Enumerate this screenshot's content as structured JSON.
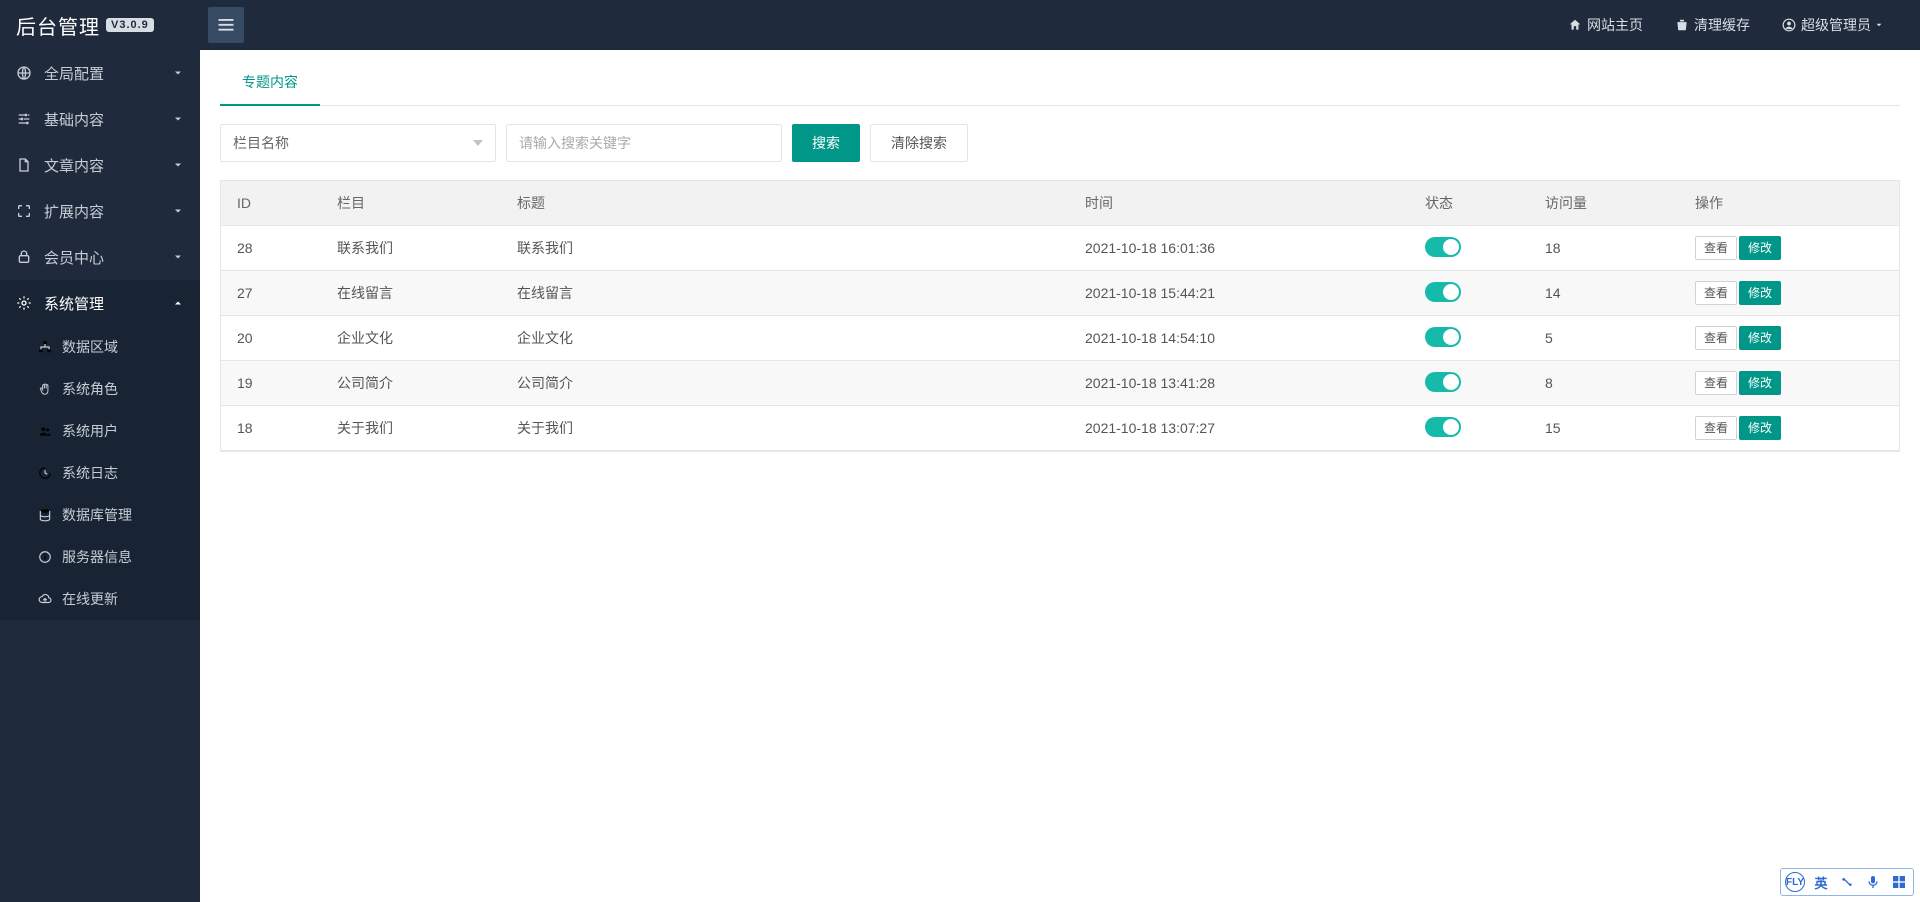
{
  "brand": {
    "title": "后台管理",
    "version": "V3.0.9"
  },
  "topbar": {
    "links": {
      "home": "网站主页",
      "cache": "清理缓存",
      "user": "超级管理员"
    }
  },
  "sidebar": {
    "items": [
      {
        "key": "global",
        "label": "全局配置",
        "icon": "globe",
        "expanded": false
      },
      {
        "key": "base",
        "label": "基础内容",
        "icon": "sliders",
        "expanded": false
      },
      {
        "key": "article",
        "label": "文章内容",
        "icon": "doc",
        "expanded": false
      },
      {
        "key": "ext",
        "label": "扩展内容",
        "icon": "expand",
        "expanded": false
      },
      {
        "key": "member",
        "label": "会员中心",
        "icon": "lock",
        "expanded": false
      },
      {
        "key": "system",
        "label": "系统管理",
        "icon": "gear",
        "expanded": true,
        "children": [
          {
            "key": "region",
            "label": "数据区域",
            "icon": "sitemap"
          },
          {
            "key": "role",
            "label": "系统角色",
            "icon": "hand"
          },
          {
            "key": "user",
            "label": "系统用户",
            "icon": "users"
          },
          {
            "key": "log",
            "label": "系统日志",
            "icon": "history"
          },
          {
            "key": "db",
            "label": "数据库管理",
            "icon": "database"
          },
          {
            "key": "server",
            "label": "服务器信息",
            "icon": "info"
          },
          {
            "key": "update",
            "label": "在线更新",
            "icon": "cloud"
          }
        ]
      }
    ]
  },
  "tabs": [
    {
      "label": "专题内容",
      "active": true
    }
  ],
  "filters": {
    "select_placeholder": "栏目名称",
    "search_placeholder": "请输入搜索关键字",
    "search_btn": "搜索",
    "clear_btn": "清除搜索"
  },
  "table": {
    "columns": {
      "id": "ID",
      "cat": "栏目",
      "title": "标题",
      "time": "时间",
      "state": "状态",
      "views": "访问量",
      "ops": "操作"
    },
    "ops": {
      "view": "查看",
      "edit": "修改"
    },
    "rows": [
      {
        "id": "28",
        "cat": "联系我们",
        "title": "联系我们",
        "time": "2021-10-18 16:01:36",
        "state": true,
        "views": "18"
      },
      {
        "id": "27",
        "cat": "在线留言",
        "title": "在线留言",
        "time": "2021-10-18 15:44:21",
        "state": true,
        "views": "14"
      },
      {
        "id": "20",
        "cat": "企业文化",
        "title": "企业文化",
        "time": "2021-10-18 14:54:10",
        "state": true,
        "views": "5"
      },
      {
        "id": "19",
        "cat": "公司简介",
        "title": "公司简介",
        "time": "2021-10-18 13:41:28",
        "state": true,
        "views": "8"
      },
      {
        "id": "18",
        "cat": "关于我们",
        "title": "关于我们",
        "time": "2021-10-18 13:07:27",
        "state": true,
        "views": "15"
      }
    ]
  },
  "ime": {
    "lang": "英"
  }
}
